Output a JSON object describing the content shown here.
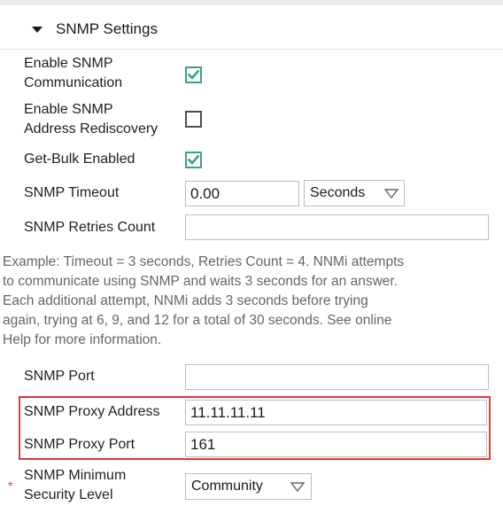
{
  "section": {
    "title": "SNMP Settings"
  },
  "fields": {
    "enable_comm": {
      "label_line1": "Enable SNMP",
      "label_line2": "Communication",
      "checked": true
    },
    "enable_rediscovery": {
      "label_line1": "Enable SNMP",
      "label_line2": "Address Rediscovery",
      "checked": false
    },
    "get_bulk": {
      "label": "Get-Bulk Enabled",
      "checked": true
    },
    "timeout": {
      "label": "SNMP Timeout",
      "value": "0.00",
      "unit": "Seconds"
    },
    "retries": {
      "label": "SNMP Retries Count",
      "value": ""
    },
    "port": {
      "label": "SNMP Port",
      "value": ""
    },
    "proxy_address": {
      "label": "SNMP Proxy Address",
      "value": "11.11.11.11"
    },
    "proxy_port": {
      "label": "SNMP Proxy Port",
      "value": "161"
    },
    "min_security": {
      "label_line1": "SNMP Minimum",
      "label_line2": "Security Level",
      "value": "Community",
      "required_marker": "*"
    }
  },
  "help_text": {
    "lines": [
      "Example: Timeout = 3 seconds, Retries Count = 4. NNMi attempts",
      "to communicate using SNMP and waits 3 seconds for an answer.",
      "Each additional attempt, NNMi adds 3 seconds before trying",
      "again, trying at 6, 9, and 12 for a total of 30 seconds. See online",
      "Help for more information."
    ]
  },
  "colors": {
    "check_accent": "#3aa37b",
    "highlight_border": "#e03a3a",
    "help_text": "#666666"
  },
  "icons": {
    "collapse": "triangle-down-icon",
    "checkmark": "checkmark-icon",
    "dropdown": "chevron-down-icon"
  }
}
